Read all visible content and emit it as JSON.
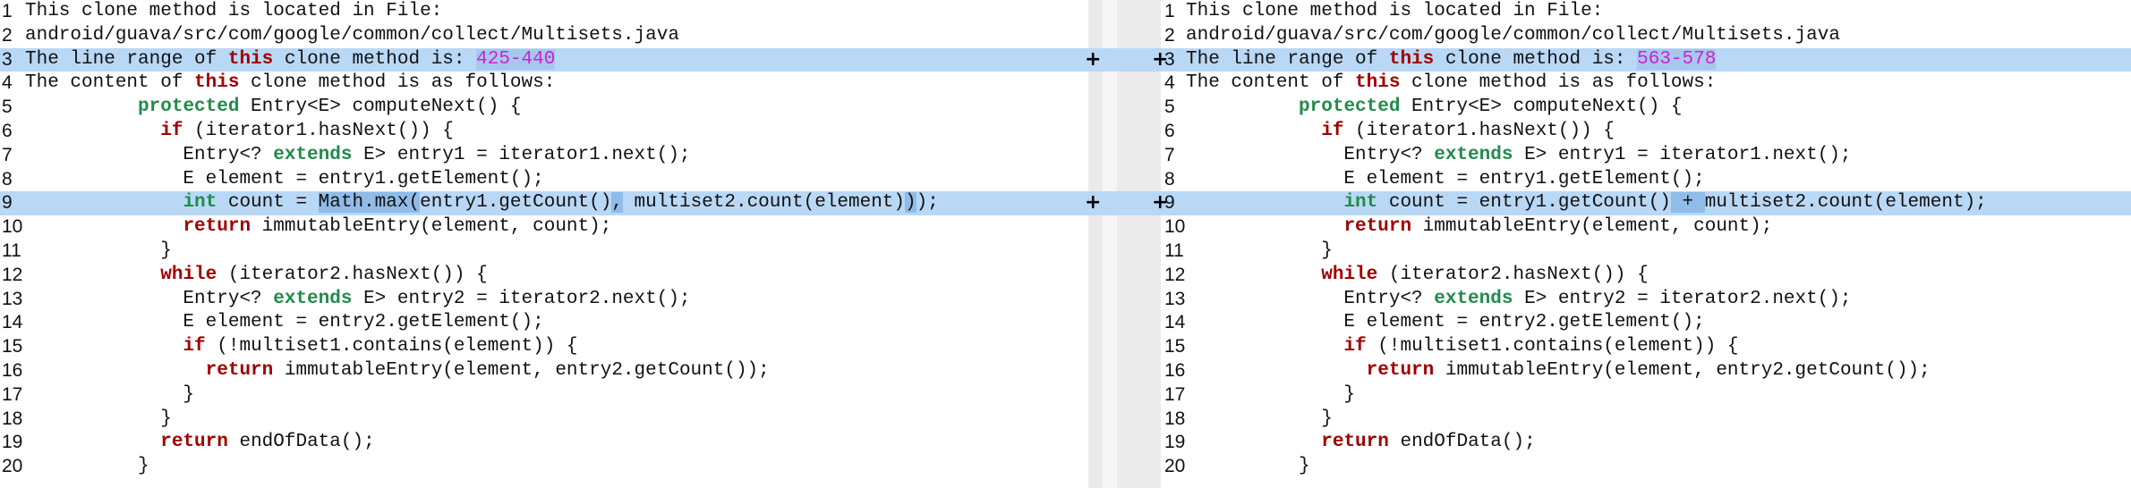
{
  "left": {
    "lines": [
      {
        "n": "1",
        "changed": false,
        "segs": [
          {
            "t": "This clone method is located in File:"
          }
        ]
      },
      {
        "n": "2",
        "changed": false,
        "segs": [
          {
            "t": "android/guava/src/com/google/common/collect/Multisets.java"
          }
        ]
      },
      {
        "n": "3",
        "changed": true,
        "segs": [
          {
            "t": "The line range of "
          },
          {
            "t": "this",
            "c": "kw"
          },
          {
            "t": " clone method is: "
          },
          {
            "t": "425",
            "c": "num-hl"
          },
          {
            "t": "-",
            "c": "num-hl"
          },
          {
            "t": "440",
            "c": "num-hl"
          }
        ]
      },
      {
        "n": "4",
        "changed": false,
        "segs": [
          {
            "t": "The content of "
          },
          {
            "t": "this",
            "c": "kw"
          },
          {
            "t": " clone method is as follows:"
          }
        ]
      },
      {
        "n": "5",
        "changed": false,
        "segs": [
          {
            "t": "          "
          },
          {
            "t": "protected",
            "c": "kw2"
          },
          {
            "t": " Entry<E> computeNext() {"
          }
        ]
      },
      {
        "n": "6",
        "changed": false,
        "segs": [
          {
            "t": "            "
          },
          {
            "t": "if",
            "c": "kw"
          },
          {
            "t": " (iterator1.hasNext()) {"
          }
        ]
      },
      {
        "n": "7",
        "changed": false,
        "segs": [
          {
            "t": "              Entry<? "
          },
          {
            "t": "extends",
            "c": "kw2"
          },
          {
            "t": " E> entry1 = iterator1.next();"
          }
        ]
      },
      {
        "n": "8",
        "changed": false,
        "segs": [
          {
            "t": "              E element = entry1.getElement();"
          }
        ]
      },
      {
        "n": "9",
        "changed": true,
        "segs": [
          {
            "t": "              "
          },
          {
            "t": "int",
            "c": "kw2"
          },
          {
            "t": " count = "
          },
          {
            "t": "Math.max(",
            "c": "hl"
          },
          {
            "t": "entry1.getCount()"
          },
          {
            "t": ",",
            "c": "hl"
          },
          {
            "t": " multiset2.count(element)"
          },
          {
            "t": ")",
            "c": "hl"
          },
          {
            "t": ");"
          }
        ]
      },
      {
        "n": "10",
        "changed": false,
        "segs": [
          {
            "t": "              "
          },
          {
            "t": "return",
            "c": "kw"
          },
          {
            "t": " immutableEntry(element, count);"
          }
        ]
      },
      {
        "n": "11",
        "changed": false,
        "segs": [
          {
            "t": "            }"
          }
        ]
      },
      {
        "n": "12",
        "changed": false,
        "segs": [
          {
            "t": "            "
          },
          {
            "t": "while",
            "c": "kw"
          },
          {
            "t": " (iterator2.hasNext()) {"
          }
        ]
      },
      {
        "n": "13",
        "changed": false,
        "segs": [
          {
            "t": "              Entry<? "
          },
          {
            "t": "extends",
            "c": "kw2"
          },
          {
            "t": " E> entry2 = iterator2.next();"
          }
        ]
      },
      {
        "n": "14",
        "changed": false,
        "segs": [
          {
            "t": "              E element = entry2.getElement();"
          }
        ]
      },
      {
        "n": "15",
        "changed": false,
        "segs": [
          {
            "t": "              "
          },
          {
            "t": "if",
            "c": "kw"
          },
          {
            "t": " (!multiset1.contains(element)) {"
          }
        ]
      },
      {
        "n": "16",
        "changed": false,
        "segs": [
          {
            "t": "                "
          },
          {
            "t": "return",
            "c": "kw"
          },
          {
            "t": " immutableEntry(element, entry2.getCount());"
          }
        ]
      },
      {
        "n": "17",
        "changed": false,
        "segs": [
          {
            "t": "              }"
          }
        ]
      },
      {
        "n": "18",
        "changed": false,
        "segs": [
          {
            "t": "            }"
          }
        ]
      },
      {
        "n": "19",
        "changed": false,
        "segs": [
          {
            "t": "            "
          },
          {
            "t": "return",
            "c": "kw"
          },
          {
            "t": " endOfData();"
          }
        ]
      },
      {
        "n": "20",
        "changed": false,
        "segs": [
          {
            "t": "          }"
          }
        ]
      }
    ]
  },
  "right": {
    "lines": [
      {
        "n": "1",
        "changed": false,
        "segs": [
          {
            "t": "This clone method is located in File:"
          }
        ]
      },
      {
        "n": "2",
        "changed": false,
        "segs": [
          {
            "t": "android/guava/src/com/google/common/collect/Multisets.java"
          }
        ]
      },
      {
        "n": "3",
        "changed": true,
        "segs": [
          {
            "t": "The line range of "
          },
          {
            "t": "this",
            "c": "kw"
          },
          {
            "t": " clone method is: "
          },
          {
            "t": "563",
            "c": "num-hl"
          },
          {
            "t": "-",
            "c": "num-hl"
          },
          {
            "t": "578",
            "c": "num-hl"
          }
        ]
      },
      {
        "n": "4",
        "changed": false,
        "segs": [
          {
            "t": "The content of "
          },
          {
            "t": "this",
            "c": "kw"
          },
          {
            "t": " clone method is as follows:"
          }
        ]
      },
      {
        "n": "5",
        "changed": false,
        "segs": [
          {
            "t": "          "
          },
          {
            "t": "protected",
            "c": "kw2"
          },
          {
            "t": " Entry<E> computeNext() {"
          }
        ]
      },
      {
        "n": "6",
        "changed": false,
        "segs": [
          {
            "t": "            "
          },
          {
            "t": "if",
            "c": "kw"
          },
          {
            "t": " (iterator1.hasNext()) {"
          }
        ]
      },
      {
        "n": "7",
        "changed": false,
        "segs": [
          {
            "t": "              Entry<? "
          },
          {
            "t": "extends",
            "c": "kw2"
          },
          {
            "t": " E> entry1 = iterator1.next();"
          }
        ]
      },
      {
        "n": "8",
        "changed": false,
        "segs": [
          {
            "t": "              E element = entry1.getElement();"
          }
        ]
      },
      {
        "n": "9",
        "changed": true,
        "segs": [
          {
            "t": "              "
          },
          {
            "t": "int",
            "c": "kw2"
          },
          {
            "t": " count = entry1.getCount()"
          },
          {
            "t": " + ",
            "c": "hl"
          },
          {
            "t": "multiset2.count(element);"
          }
        ]
      },
      {
        "n": "10",
        "changed": false,
        "segs": [
          {
            "t": "              "
          },
          {
            "t": "return",
            "c": "kw"
          },
          {
            "t": " immutableEntry(element, count);"
          }
        ]
      },
      {
        "n": "11",
        "changed": false,
        "segs": [
          {
            "t": "            }"
          }
        ]
      },
      {
        "n": "12",
        "changed": false,
        "segs": [
          {
            "t": "            "
          },
          {
            "t": "while",
            "c": "kw"
          },
          {
            "t": " (iterator2.hasNext()) {"
          }
        ]
      },
      {
        "n": "13",
        "changed": false,
        "segs": [
          {
            "t": "              Entry<? "
          },
          {
            "t": "extends",
            "c": "kw2"
          },
          {
            "t": " E> entry2 = iterator2.next();"
          }
        ]
      },
      {
        "n": "14",
        "changed": false,
        "segs": [
          {
            "t": "              E element = entry2.getElement();"
          }
        ]
      },
      {
        "n": "15",
        "changed": false,
        "segs": [
          {
            "t": "              "
          },
          {
            "t": "if",
            "c": "kw"
          },
          {
            "t": " (!multiset1.contains(element)) {"
          }
        ]
      },
      {
        "n": "16",
        "changed": false,
        "segs": [
          {
            "t": "                "
          },
          {
            "t": "return",
            "c": "kw"
          },
          {
            "t": " immutableEntry(element, entry2.getCount());"
          }
        ]
      },
      {
        "n": "17",
        "changed": false,
        "segs": [
          {
            "t": "              }"
          }
        ]
      },
      {
        "n": "18",
        "changed": false,
        "segs": [
          {
            "t": "            }"
          }
        ]
      },
      {
        "n": "19",
        "changed": false,
        "segs": [
          {
            "t": "            "
          },
          {
            "t": "return",
            "c": "kw"
          },
          {
            "t": " endOfData();"
          }
        ]
      },
      {
        "n": "20",
        "changed": false,
        "segs": [
          {
            "t": "          }"
          }
        ]
      }
    ]
  },
  "marks": {
    "glyph": "+",
    "rows": [
      "3",
      "9"
    ]
  },
  "colors": {
    "changed_line_bg": "#b9d8f6",
    "inline_highlight": "#8fbce9",
    "keyword_red": "#a00000",
    "keyword_green": "#228b4b",
    "range_number": "#d020d0"
  }
}
